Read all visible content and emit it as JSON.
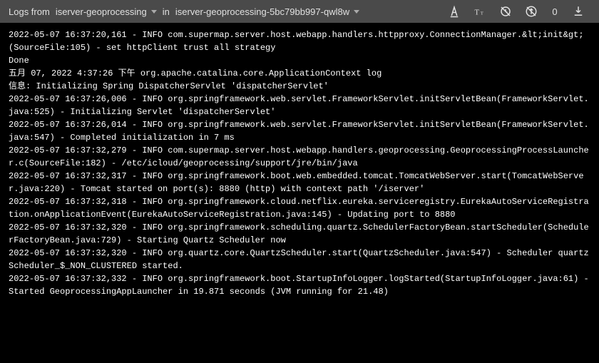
{
  "toolbar": {
    "logs_from_label": "Logs from",
    "container_name": "iserver-geoprocessing",
    "in_label": "in",
    "pod_name": "iserver-geoprocessing-5bc79bb997-qwl8w",
    "counter": "0"
  },
  "logs": [
    "2022-05-07 16:37:20,161 - INFO com.supermap.server.host.webapp.handlers.httpproxy.ConnectionManager.&lt;init&gt;(SourceFile:105) - set httpClient trust all strategy",
    "Done",
    "五月 07, 2022 4:37:26 下午 org.apache.catalina.core.ApplicationContext log",
    "信息: Initializing Spring DispatcherServlet 'dispatcherServlet'",
    "2022-05-07 16:37:26,006 - INFO org.springframework.web.servlet.FrameworkServlet.initServletBean(FrameworkServlet.java:525) - Initializing Servlet 'dispatcherServlet'",
    "2022-05-07 16:37:26,014 - INFO org.springframework.web.servlet.FrameworkServlet.initServletBean(FrameworkServlet.java:547) - Completed initialization in 7 ms",
    "2022-05-07 16:37:32,279 - INFO com.supermap.server.host.webapp.handlers.geoprocessing.GeoprocessingProcessLauncher.c(SourceFile:182) - /etc/icloud/geoprocessing/support/jre/bin/java",
    "2022-05-07 16:37:32,317 - INFO org.springframework.boot.web.embedded.tomcat.TomcatWebServer.start(TomcatWebServer.java:220) - Tomcat started on port(s): 8880 (http) with context path '/iserver'",
    "2022-05-07 16:37:32,318 - INFO org.springframework.cloud.netflix.eureka.serviceregistry.EurekaAutoServiceRegistration.onApplicationEvent(EurekaAutoServiceRegistration.java:145) - Updating port to 8880",
    "2022-05-07 16:37:32,320 - INFO org.springframework.scheduling.quartz.SchedulerFactoryBean.startScheduler(SchedulerFactoryBean.java:729) - Starting Quartz Scheduler now",
    "2022-05-07 16:37:32,320 - INFO org.quartz.core.QuartzScheduler.start(QuartzScheduler.java:547) - Scheduler quartzScheduler_$_NON_CLUSTERED started.",
    "2022-05-07 16:37:32,332 - INFO org.springframework.boot.StartupInfoLogger.logStarted(StartupInfoLogger.java:61) - Started GeoprocessingAppLauncher in 19.871 seconds (JVM running for 21.48)"
  ]
}
